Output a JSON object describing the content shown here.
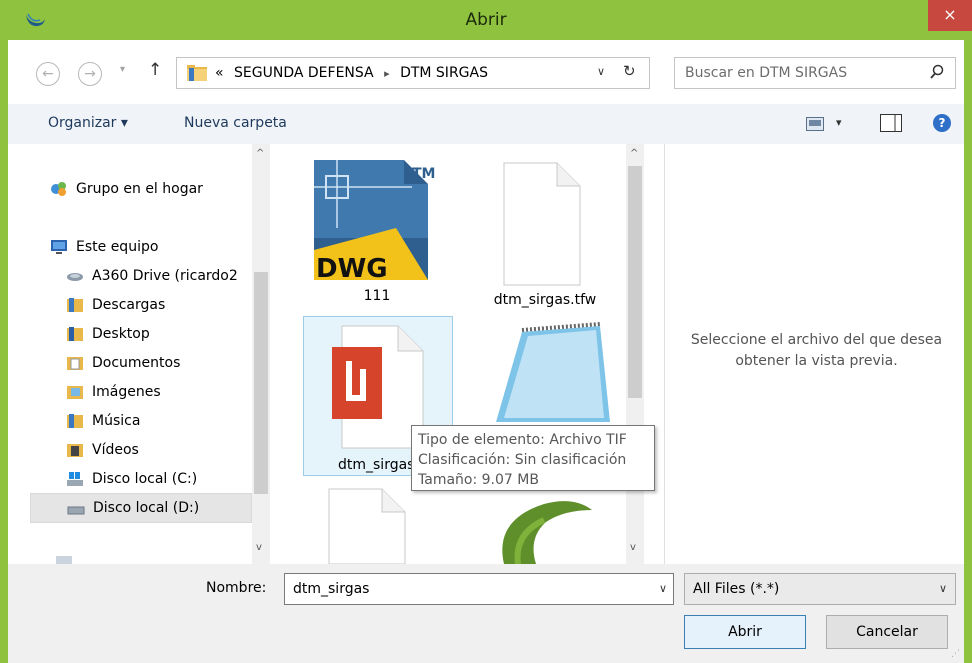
{
  "window": {
    "title": "Abrir",
    "close_glyph": "×"
  },
  "nav": {
    "back_glyph": "←",
    "forward_glyph": "→",
    "recent_glyph": "▾",
    "up_glyph": "↑",
    "breadcrumb_prefix": "«",
    "breadcrumb": [
      "SEGUNDA DEFENSA",
      "DTM SIRGAS"
    ],
    "breadcrumb_sep": "▸",
    "dropdown_glyph": "∨",
    "refresh_glyph": "↻",
    "search_placeholder": "Buscar en DTM SIRGAS"
  },
  "toolbar": {
    "organize_label": "Organizar ▾",
    "new_folder_label": "Nueva carpeta",
    "view_dropdown_glyph": "▾",
    "help_glyph": "?"
  },
  "sidebar": {
    "items": [
      {
        "label": "Grupo en el hogar",
        "icon": "homegroup-icon"
      },
      {
        "label": "Este equipo",
        "icon": "computer-icon"
      },
      {
        "label": "A360 Drive (ricardo2",
        "icon": "cloud-drive-icon"
      },
      {
        "label": "Descargas",
        "icon": "downloads-folder-icon"
      },
      {
        "label": "Desktop",
        "icon": "desktop-folder-icon"
      },
      {
        "label": "Documentos",
        "icon": "documents-folder-icon"
      },
      {
        "label": "Imágenes",
        "icon": "pictures-folder-icon"
      },
      {
        "label": "Música",
        "icon": "music-folder-icon"
      },
      {
        "label": "Vídeos",
        "icon": "videos-folder-icon"
      },
      {
        "label": "Disco local (C:)",
        "icon": "windows-drive-icon"
      },
      {
        "label": "Disco local (D:)",
        "icon": "drive-icon"
      }
    ],
    "scroll_up": "^",
    "scroll_down": "v"
  },
  "files": [
    {
      "name": "111",
      "icon": "dwg-file-icon",
      "badge": "DWG",
      "tm": "TM"
    },
    {
      "name": "dtm_sirgas.tfw",
      "icon": "blank-file-icon"
    },
    {
      "name": "dtm_sirgas",
      "icon": "tif-file-icon"
    },
    {
      "name": "",
      "icon": "notepad-file-icon"
    },
    {
      "name": "",
      "icon": "blank-file-icon"
    },
    {
      "name": "",
      "icon": "app-logo-file-icon"
    }
  ],
  "tooltip": {
    "lines": [
      "Tipo de elemento: Archivo TIF",
      "Clasificación: Sin clasificación",
      "Tamaño: 9.07 MB"
    ]
  },
  "preview": {
    "message": "Seleccione el archivo del que desea obtener la vista previa."
  },
  "footer": {
    "name_label": "Nombre:",
    "name_value": "dtm_sirgas",
    "dropdown_glyph": "∨",
    "filter_value": "All Files (*.*)",
    "open_label": "Abrir",
    "cancel_label": "Cancelar"
  }
}
